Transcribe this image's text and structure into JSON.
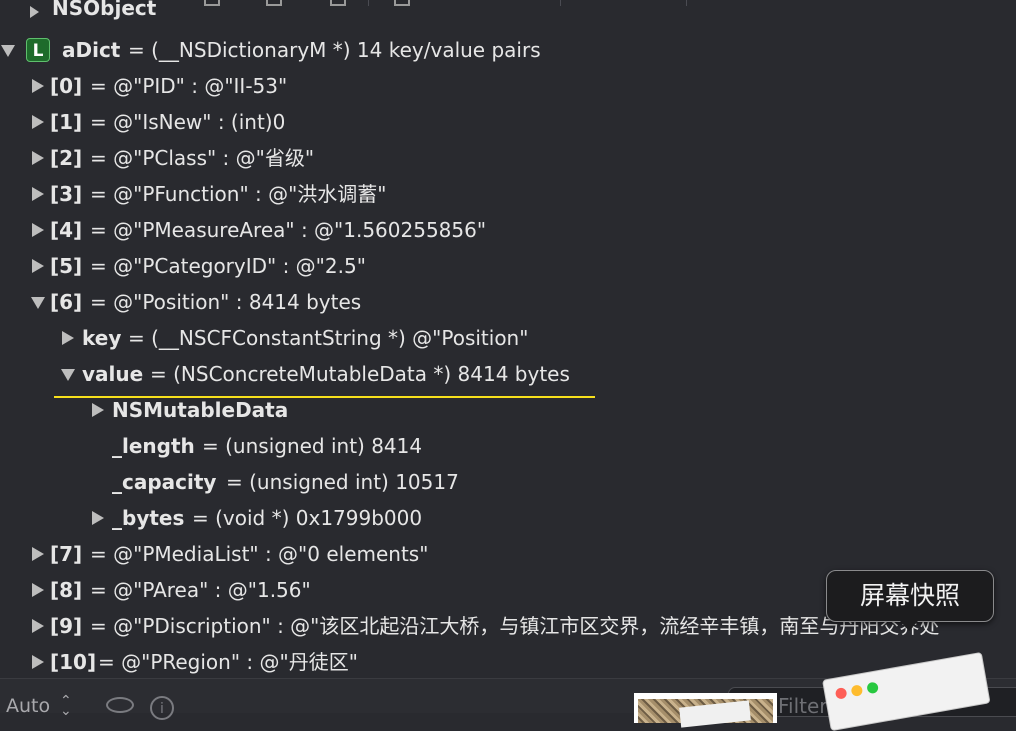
{
  "top_partial": "NSObject",
  "root": {
    "badge": "L",
    "name": "aDict",
    "desc": "= (__NSDictionaryM *) 14 key/value pairs"
  },
  "entries": [
    {
      "index": "[0]",
      "text": "= @\"PID\" : @\"II-53\""
    },
    {
      "index": "[1]",
      "text": "= @\"IsNew\" : (int)0"
    },
    {
      "index": "[2]",
      "text": "= @\"PClass\" : @\"省级\""
    },
    {
      "index": "[3]",
      "text": "= @\"PFunction\" : @\"洪水调蓄\""
    },
    {
      "index": "[4]",
      "text": "= @\"PMeasureArea\" : @\"1.560255856\""
    },
    {
      "index": "[5]",
      "text": "= @\"PCategoryID\" : @\"2.5\""
    },
    {
      "index": "[6]",
      "text": "= @\"Position\" : 8414 bytes"
    },
    {
      "index": "[7]",
      "text": "= @\"PMediaList\" : @\"0 elements\""
    },
    {
      "index": "[8]",
      "text": "= @\"PArea\" : @\"1.56\""
    },
    {
      "index": "[9]",
      "text": "= @\"PDiscription\" : @\"该区北起沿江大桥，与镇江市区交界，流经辛丰镇，南至与丹阳交界处"
    },
    {
      "index": "[10]",
      "text": "= @\"PRegion\" : @\"丹徒区\""
    }
  ],
  "position_children": {
    "key": {
      "name": "key",
      "desc": "= (__NSCFConstantString *) @\"Position\""
    },
    "value": {
      "name": "value",
      "desc": "= (NSConcreteMutableData *) 8414 bytes"
    },
    "value_children": [
      {
        "name": "NSMutableData",
        "desc": ""
      },
      {
        "name": "_length",
        "desc": "= (unsigned int) 8414"
      },
      {
        "name": "_capacity",
        "desc": "= (unsigned int) 10517"
      },
      {
        "name": "_bytes",
        "desc": "= (void *) 0x1799b000"
      }
    ]
  },
  "tooltip": "屏幕快照",
  "bottom_bar": {
    "scope_label": "Auto",
    "filter_placeholder": "Filter"
  },
  "colors": {
    "background": "#292a2f",
    "highlight_underline": "#f7e01c",
    "badge_green": "#1e6b2b"
  }
}
